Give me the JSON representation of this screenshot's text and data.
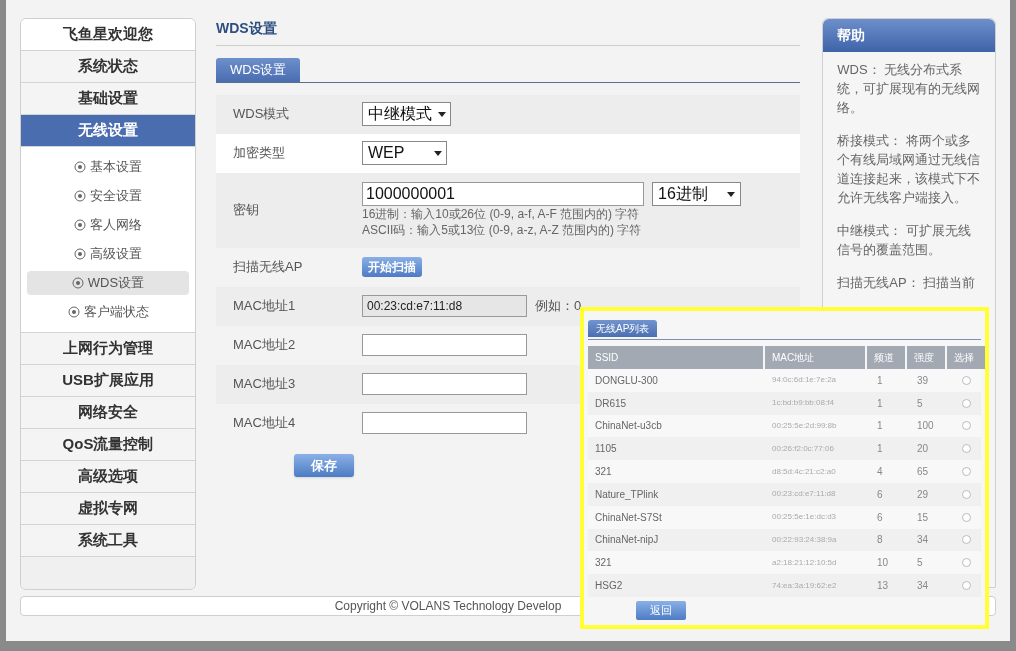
{
  "sidebar": {
    "items": [
      {
        "label": "飞鱼星欢迎您",
        "kind": "welcome"
      },
      {
        "label": "系统状态",
        "kind": "item",
        "selected": false
      },
      {
        "label": "基础设置",
        "kind": "item",
        "selected": false
      },
      {
        "label": "无线设置",
        "kind": "item",
        "selected": true,
        "children": [
          {
            "label": "基本设置",
            "selected": false
          },
          {
            "label": "安全设置",
            "selected": false
          },
          {
            "label": "客人网络",
            "selected": false
          },
          {
            "label": "高级设置",
            "selected": false
          },
          {
            "label": "WDS设置",
            "selected": true
          },
          {
            "label": "客户端状态",
            "selected": false
          }
        ]
      },
      {
        "label": "上网行为管理",
        "kind": "item",
        "selected": false
      },
      {
        "label": "USB扩展应用",
        "kind": "item",
        "selected": false
      },
      {
        "label": "网络安全",
        "kind": "item",
        "selected": false
      },
      {
        "label": "QoS流量控制",
        "kind": "item",
        "selected": false
      },
      {
        "label": "高级选项",
        "kind": "item",
        "selected": false
      },
      {
        "label": "虚拟专网",
        "kind": "item",
        "selected": false
      },
      {
        "label": "系统工具",
        "kind": "item",
        "selected": false
      }
    ]
  },
  "page_title": "WDS设置",
  "tabs": [
    {
      "label": "WDS设置",
      "selected": true
    }
  ],
  "form": {
    "rows": [
      {
        "kind": "select",
        "label": "WDS模式",
        "value": "中继模式"
      },
      {
        "kind": "select",
        "label": "加密类型",
        "value": "WEP"
      },
      {
        "kind": "key",
        "label": "密钥",
        "value": "1000000001",
        "format": "16进制",
        "hints": [
          "16进制：输入10或26位 (0-9, a-f, A-F 范围内的) 字符",
          "ASCII码：输入5或13位 (0-9, a-z, A-Z 范围内的) 字符"
        ]
      },
      {
        "kind": "scan",
        "label": "扫描无线AP",
        "button": "开始扫描"
      },
      {
        "kind": "text",
        "label": "MAC地址1",
        "value": "00:23:cd:e7:11:d8",
        "example": "例如：0"
      },
      {
        "kind": "text",
        "label": "MAC地址2"
      },
      {
        "kind": "text",
        "label": "MAC地址3"
      },
      {
        "kind": "text",
        "label": "MAC地址4"
      }
    ],
    "save_button": "保存"
  },
  "help": {
    "title": "帮助",
    "paragraphs": [
      "WDS：  无线分布式系统，可扩展现有的无线网络。",
      "桥接模式：  将两个或多个有线局域网通过无线信道连接起来，该模式下不允许无线客户端接入。",
      "中继模式：  可扩展无线信号的覆盖范围。",
      "扫描无线AP：  扫描当前"
    ]
  },
  "footer": "Copyright © VOLANS Technology Develop",
  "ap_list": {
    "tab": "无线AP列表",
    "columns": [
      "SSID",
      "MAC地址",
      "频道",
      "强度",
      "选择"
    ],
    "rows": [
      {
        "ssid": "DONGLU-300",
        "mac": "94:0c:6d:1e:7e:2a",
        "channel": "1",
        "strength": "39",
        "selected": false
      },
      {
        "ssid": "DR615",
        "mac": "1c:bd:b9:bb:08:f4",
        "channel": "1",
        "strength": "5",
        "selected": false
      },
      {
        "ssid": "ChinaNet-u3cb",
        "mac": "00:25:5e:2d:99:8b",
        "channel": "1",
        "strength": "100",
        "selected": false
      },
      {
        "ssid": "1105",
        "mac": "00:26:f2:0c:77:06",
        "channel": "1",
        "strength": "20",
        "selected": false
      },
      {
        "ssid": "321",
        "mac": "d8:5d:4c:21:c2:a0",
        "channel": "4",
        "strength": "65",
        "selected": false
      },
      {
        "ssid": "Nature_TPlink",
        "mac": "00:23:cd:e7:11:d8",
        "channel": "6",
        "strength": "29",
        "selected": false
      },
      {
        "ssid": "ChinaNet-S7St",
        "mac": "00:25:5e:1e:dc:d3",
        "channel": "6",
        "strength": "15",
        "selected": false
      },
      {
        "ssid": "ChinaNet-nipJ",
        "mac": "00:22:93:24:38:9a",
        "channel": "8",
        "strength": "34",
        "selected": false
      },
      {
        "ssid": "321",
        "mac": "a2:18:21:12:10:5d",
        "channel": "10",
        "strength": "5",
        "selected": false
      },
      {
        "ssid": "HSG2",
        "mac": "74:ea:3a:19:62:e2",
        "channel": "13",
        "strength": "34",
        "selected": false
      }
    ],
    "back_button": "返回"
  }
}
